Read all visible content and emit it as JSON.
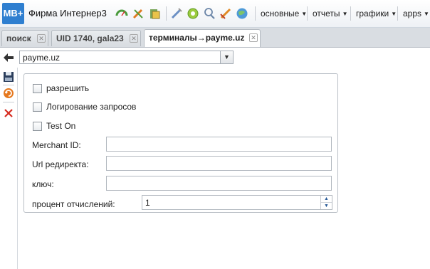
{
  "header": {
    "logo": "MB+",
    "company": "Фирма Интернер3",
    "toolbar_icons": [
      "speed-icon",
      "tools-icon",
      "money-icon",
      "pen-icon",
      "gear-wheel-icon",
      "search-icon",
      "settings-wrench-icon",
      "globe-icon"
    ],
    "menus": [
      {
        "label": "основные"
      },
      {
        "label": "отчеты"
      },
      {
        "label": "графики"
      },
      {
        "label": "apps"
      }
    ]
  },
  "tabs": [
    {
      "label": "поиск",
      "active": false
    },
    {
      "label": "UID 1740, gala23",
      "active": false
    },
    {
      "label": "терминалы→payme.uz",
      "active": true
    }
  ],
  "selector": {
    "value": "payme.uz"
  },
  "sidebar_icons": [
    "save-icon",
    "refresh-icon",
    "delete-icon"
  ],
  "form": {
    "checkboxes": [
      {
        "label": "разрешить",
        "checked": false
      },
      {
        "label": "Логирование запросов",
        "checked": false
      },
      {
        "label": "Test On",
        "checked": false
      }
    ],
    "fields": [
      {
        "label": "Merchant ID:",
        "value": ""
      },
      {
        "label": "Url редиректа:",
        "value": ""
      },
      {
        "label": "ключ:",
        "value": ""
      }
    ],
    "percent": {
      "label": "процент отчислений:",
      "value": "1"
    }
  }
}
